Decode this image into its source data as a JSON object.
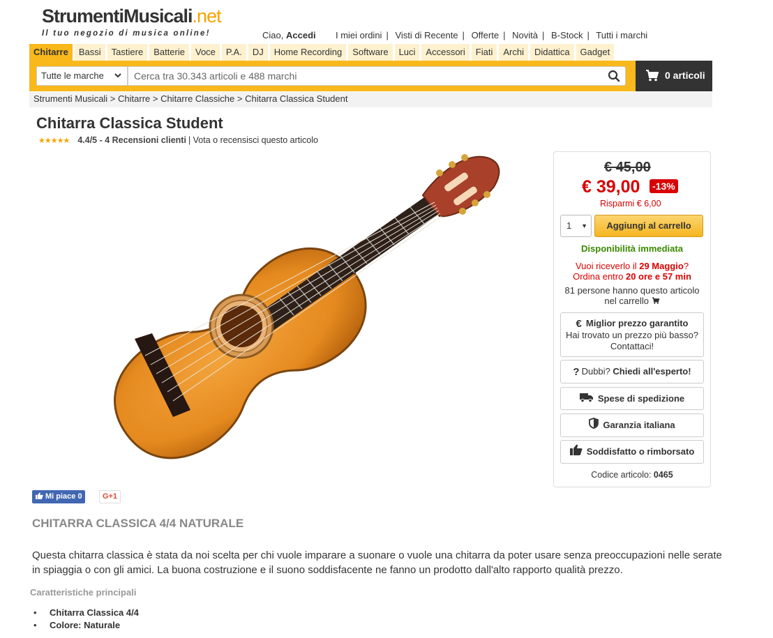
{
  "header": {
    "logo_main": "StrumentiMusicali",
    "logo_net": ".net",
    "tagline": "Il tuo negozio di musica online!",
    "greeting": "Ciao,",
    "login": "Accedi",
    "links": [
      "I miei ordini",
      "Visti di Recente",
      "Offerte",
      "Novità",
      "B-Stock",
      "Tutti i marchi"
    ]
  },
  "categories": [
    "Chitarre",
    "Bassi",
    "Tastiere",
    "Batterie",
    "Voce",
    "P.A.",
    "DJ",
    "Home Recording",
    "Software",
    "Luci",
    "Accessori",
    "Fiati",
    "Archi",
    "Didattica",
    "Gadget"
  ],
  "search": {
    "brand_select": "Tutte le marche",
    "placeholder": "Cerca tra 30.343 articoli e 488 marchi"
  },
  "cart": {
    "label": "0 articoli"
  },
  "breadcrumb": "Strumenti Musicali > Chitarre > Chitarre Classiche > Chitarra Classica Student",
  "product": {
    "title": "Chitarra Classica Student",
    "stars": "★★★★★",
    "rating": 4.4,
    "rating_text": "4.4/5 - 4 Recensioni clienti",
    "vote_text": "| Vota o recensisci questo articolo",
    "old_price": "€ 45,00",
    "price": "€ 39,00",
    "discount": "-13%",
    "savings": "Risparmi € 6,00",
    "qty": "1",
    "add_to_cart": "Aggiungi al carrello",
    "availability": "Disponibilità immediata",
    "delivery_pre": "Vuoi riceverlo il",
    "delivery_date": "29 Maggio",
    "delivery_q": "?",
    "order_pre": "Ordina entro",
    "order_time": "20 ore e 57 min",
    "in_cart_line1": "81 persone hanno questo articolo",
    "in_cart_line2": "nel carrello",
    "best_price_title": "Miglior prezzo garantito",
    "best_price_line1": "Hai trovato un prezzo più basso?",
    "best_price_line2": "Contattaci!",
    "doubts_pre": "Dubbi?",
    "doubts_link": "Chiedi all'esperto!",
    "shipping": "Spese di spedizione",
    "warranty": "Garanzia italiana",
    "refund": "Soddisfatto o rimborsato",
    "code_label": "Codice articolo:",
    "code_value": "0465"
  },
  "social": {
    "fb_label": "Mi piace 0",
    "gplus_label": "G+1"
  },
  "description": {
    "heading": "CHITARRA CLASSICA 4/4 NATURALE",
    "body": "Questa chitarra classica è stata da noi scelta per chi vuole imparare a suonare o vuole una chitarra da poter usare senza preoccupazioni nelle serate in spiaggia o con gli amici. La buona costruzione e il suono soddisfacente ne fanno un prodotto dall'alto rapporto qualità prezzo.",
    "features_heading": "Caratteristiche principali",
    "features": [
      "Chitarra Classica 4/4",
      "Colore: Naturale"
    ]
  },
  "colors": {
    "accent": "#f9b81b",
    "price_red": "#d90000",
    "available_green": "#3a8a00",
    "cart_bg": "#333333"
  }
}
